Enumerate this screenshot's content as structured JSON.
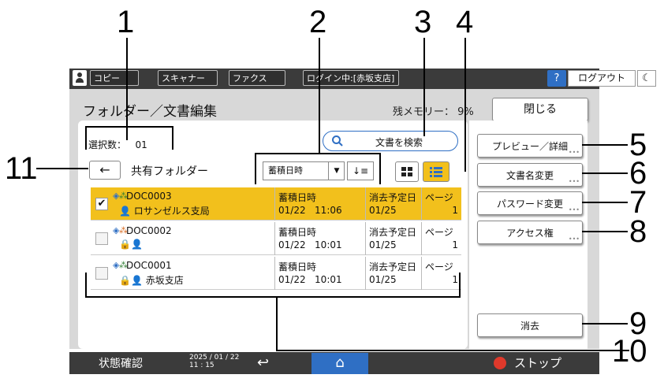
{
  "topbar": {
    "tabs": [
      "コピー",
      "スキャナー",
      "ファクス",
      "ログイン中:[赤坂支店]"
    ],
    "help_label": "?",
    "logout_label": "ログアウト",
    "moon_label": "☾"
  },
  "header": {
    "title": "フォルダー／文書編集",
    "memory_label": "残メモリー：",
    "memory_value": "9%",
    "close_label": "閉じる"
  },
  "selection": {
    "label": "選択数：",
    "value": "01"
  },
  "search": {
    "label": "文書を検索"
  },
  "folder": {
    "back_label": "←",
    "name": "共有フォルダー"
  },
  "sort": {
    "selected": "蓄積日時",
    "order_label": "↓≡"
  },
  "columns": {
    "stored": "蓄積日時",
    "delete": "消去予定日",
    "pages": "ページ"
  },
  "documents": [
    {
      "name": "DOC0003",
      "owner": "ロサンゼルス支局",
      "stored_date": "01/22",
      "stored_time": "11:06",
      "delete_date": "01/25",
      "pages": "1",
      "selected": true,
      "check": "✔"
    },
    {
      "name": "DOC0002",
      "owner": "",
      "stored_date": "01/22",
      "stored_time": "10:01",
      "delete_date": "01/25",
      "pages": "1",
      "selected": false,
      "check": ""
    },
    {
      "name": "DOC0001",
      "owner": "赤坂支店",
      "stored_date": "01/22",
      "stored_time": "10:01",
      "delete_date": "01/25",
      "pages": "1",
      "selected": false,
      "check": ""
    }
  ],
  "side_buttons": {
    "preview": "プレビュー／詳細",
    "rename": "文書名変更",
    "password": "パスワード変更",
    "access": "アクセス権",
    "delete": "消去"
  },
  "footer": {
    "status_label": "状態確認",
    "date": "2025 / 01 / 22",
    "time": "11 : 15",
    "stop_label": "ストップ"
  },
  "callouts": [
    "1",
    "2",
    "3",
    "4",
    "5",
    "6",
    "7",
    "8",
    "9",
    "10",
    "11"
  ],
  "colors": {
    "accent": "#f2c01c",
    "brand_blue": "#2f6fc4",
    "bar": "#3b3b3b"
  }
}
